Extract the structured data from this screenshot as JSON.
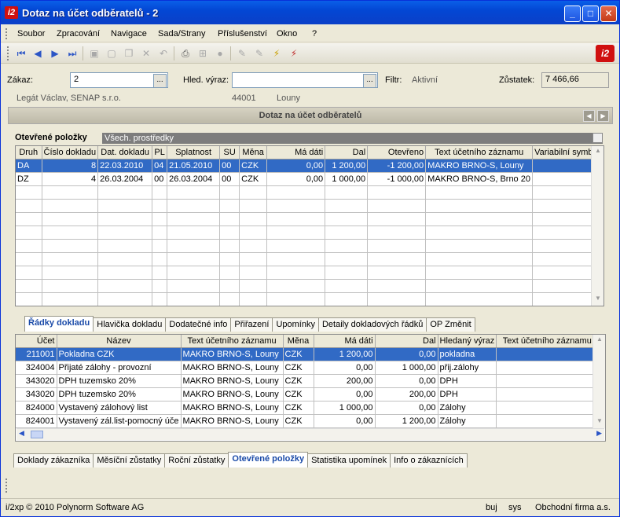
{
  "window": {
    "title": "Dotaz na účet odběratelů - 2",
    "app_icon": "i2"
  },
  "menu": [
    "Soubor",
    "Zpracování",
    "Navigace",
    "Sada/Strany",
    "Příslušenství",
    "Okno",
    "?"
  ],
  "filter": {
    "zakaz_label": "Zákaz:",
    "zakaz_value": "2",
    "hled_label": "Hled. výraz:",
    "hled_value": "",
    "filtr_label": "Filtr:",
    "filtr_value": "Aktivní",
    "zustatek_label": "Zůstatek:",
    "zustatek_value": "7 466,66",
    "customer_name": "Legát Václav, SENAP s.r.o.",
    "zip": "44001",
    "city": "Louny",
    "dots": "..."
  },
  "panel_title": "Dotaz na účet odběratelů",
  "open_items": {
    "label": "Otevřené položky",
    "filter_value": "Všech. prostředky",
    "columns": [
      "Druh",
      "Číslo dokladu",
      "Dat. dokladu",
      "PL",
      "Splatnost",
      "SU",
      "Měna",
      "Má dáti",
      "Dal",
      "Otevřeno",
      "Text účetního záznamu",
      "Variabilní symb."
    ],
    "rows": [
      [
        "DA",
        "8",
        "22.03.2010",
        "04",
        "21.05.2010",
        "00",
        "CZK",
        "0,00",
        "1 200,00",
        "-1 200,00",
        "MAKRO BRNO-S, Louny",
        ""
      ],
      [
        "DZ",
        "4",
        "26.03.2004",
        "00",
        "26.03.2004",
        "00",
        "CZK",
        "0,00",
        "1 000,00",
        "-1 000,00",
        "MAKRO BRNO-S, Brno 20",
        ""
      ]
    ]
  },
  "detail_tabs": [
    "Řádky dokladu",
    "Hlavička dokladu",
    "Dodatečné info",
    "Přiřazení",
    "Upomínky",
    "Detaily dokladových řádků",
    "OP Změnit"
  ],
  "lines": {
    "columns": [
      "Účet",
      "Název",
      "Text účetního záznamu",
      "Měna",
      "Má dáti",
      "Dal",
      "Hledaný výraz",
      "Text účetního záznamu"
    ],
    "rows": [
      [
        "211001",
        "Pokladna CZK",
        "MAKRO BRNO-S, Louny",
        "CZK",
        "1 200,00",
        "0,00",
        "pokladna",
        ""
      ],
      [
        "324004",
        "Přijaté zálohy - provozní",
        "MAKRO BRNO-S, Louny",
        "CZK",
        "0,00",
        "1 000,00",
        "přij.zálohy",
        ""
      ],
      [
        "343020",
        "DPH tuzemsko 20%",
        "MAKRO BRNO-S, Louny",
        "CZK",
        "200,00",
        "0,00",
        "DPH",
        ""
      ],
      [
        "343020",
        "DPH tuzemsko 20%",
        "MAKRO BRNO-S, Louny",
        "CZK",
        "0,00",
        "200,00",
        "DPH",
        ""
      ],
      [
        "824000",
        "Vystavený zálohový list",
        "MAKRO BRNO-S, Louny",
        "CZK",
        "1 000,00",
        "0,00",
        "Zálohy",
        ""
      ],
      [
        "824001",
        "Vystavený zál.list-pomocný úče",
        "MAKRO BRNO-S, Louny",
        "CZK",
        "0,00",
        "1 200,00",
        "Zálohy",
        ""
      ]
    ]
  },
  "bottom_tabs": [
    "Doklady zákazníka",
    "Měsíční zůstatky",
    "Roční zůstatky",
    "Otevřené položky",
    "Statistika upomínek",
    "Info o zákaznících"
  ],
  "status": {
    "copyright": "i/2xp © 2010 Polynorm Software AG",
    "user": "buj",
    "db": "sys",
    "firm": "Obchodní firma a.s."
  },
  "colors": {
    "selection": "#316ac5",
    "title_blue": "#0a5fe8",
    "logo_red": "#d01010"
  }
}
